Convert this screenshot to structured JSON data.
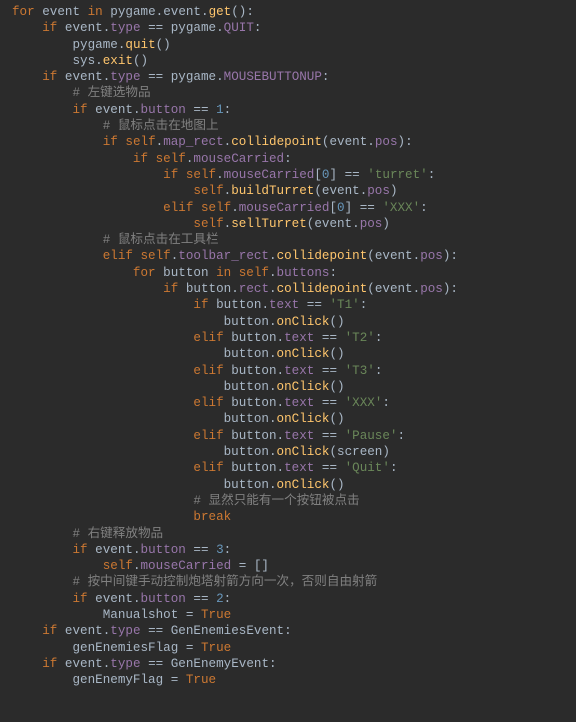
{
  "code": {
    "lines": [
      [
        [
          "kw",
          "for "
        ],
        [
          "id",
          "event "
        ],
        [
          "kw",
          "in "
        ],
        [
          "id",
          "pygame"
        ],
        [
          "op",
          "."
        ],
        [
          "id",
          "event"
        ],
        [
          "op",
          "."
        ],
        [
          "fn",
          "get"
        ],
        [
          "op",
          "():"
        ]
      ],
      [
        [
          "op",
          "    "
        ],
        [
          "kw",
          "if "
        ],
        [
          "id",
          "event"
        ],
        [
          "op",
          "."
        ],
        [
          "attr",
          "type"
        ],
        [
          "op",
          " == "
        ],
        [
          "id",
          "pygame"
        ],
        [
          "op",
          "."
        ],
        [
          "attr",
          "QUIT"
        ],
        [
          "op",
          ":"
        ]
      ],
      [
        [
          "op",
          "        "
        ],
        [
          "id",
          "pygame"
        ],
        [
          "op",
          "."
        ],
        [
          "fn",
          "quit"
        ],
        [
          "op",
          "()"
        ]
      ],
      [
        [
          "op",
          "        "
        ],
        [
          "id",
          "sys"
        ],
        [
          "op",
          "."
        ],
        [
          "fn",
          "exit"
        ],
        [
          "op",
          "()"
        ]
      ],
      [
        [
          "op",
          "    "
        ],
        [
          "kw",
          "if "
        ],
        [
          "id",
          "event"
        ],
        [
          "op",
          "."
        ],
        [
          "attr",
          "type"
        ],
        [
          "op",
          " == "
        ],
        [
          "id",
          "pygame"
        ],
        [
          "op",
          "."
        ],
        [
          "attr",
          "MOUSEBUTTONUP"
        ],
        [
          "op",
          ":"
        ]
      ],
      [
        [
          "op",
          "        "
        ],
        [
          "cmt",
          "# 左键选物品"
        ]
      ],
      [
        [
          "op",
          "        "
        ],
        [
          "kw",
          "if "
        ],
        [
          "id",
          "event"
        ],
        [
          "op",
          "."
        ],
        [
          "attr",
          "button"
        ],
        [
          "op",
          " == "
        ],
        [
          "num",
          "1"
        ],
        [
          "op",
          ":"
        ]
      ],
      [
        [
          "op",
          "            "
        ],
        [
          "cmt",
          "# 鼠标点击在地图上"
        ]
      ],
      [
        [
          "op",
          "            "
        ],
        [
          "kw",
          "if "
        ],
        [
          "kw",
          "self"
        ],
        [
          "op",
          "."
        ],
        [
          "attr",
          "map_rect"
        ],
        [
          "op",
          "."
        ],
        [
          "fn",
          "collidepoint"
        ],
        [
          "op",
          "("
        ],
        [
          "id",
          "event"
        ],
        [
          "op",
          "."
        ],
        [
          "attr",
          "pos"
        ],
        [
          "op",
          "):"
        ]
      ],
      [
        [
          "op",
          "                "
        ],
        [
          "kw",
          "if "
        ],
        [
          "kw",
          "self"
        ],
        [
          "op",
          "."
        ],
        [
          "attr",
          "mouseCarried"
        ],
        [
          "op",
          ":"
        ]
      ],
      [
        [
          "op",
          "                    "
        ],
        [
          "kw",
          "if "
        ],
        [
          "kw",
          "self"
        ],
        [
          "op",
          "."
        ],
        [
          "attr",
          "mouseCarried"
        ],
        [
          "op",
          "["
        ],
        [
          "num",
          "0"
        ],
        [
          "op",
          "] == "
        ],
        [
          "str",
          "'turret'"
        ],
        [
          "op",
          ":"
        ]
      ],
      [
        [
          "op",
          "                        "
        ],
        [
          "kw",
          "self"
        ],
        [
          "op",
          "."
        ],
        [
          "fn",
          "buildTurret"
        ],
        [
          "op",
          "("
        ],
        [
          "id",
          "event"
        ],
        [
          "op",
          "."
        ],
        [
          "attr",
          "pos"
        ],
        [
          "op",
          ")"
        ]
      ],
      [
        [
          "op",
          "                    "
        ],
        [
          "kw",
          "elif "
        ],
        [
          "kw",
          "self"
        ],
        [
          "op",
          "."
        ],
        [
          "attr",
          "mouseCarried"
        ],
        [
          "op",
          "["
        ],
        [
          "num",
          "0"
        ],
        [
          "op",
          "] == "
        ],
        [
          "str",
          "'XXX'"
        ],
        [
          "op",
          ":"
        ]
      ],
      [
        [
          "op",
          "                        "
        ],
        [
          "kw",
          "self"
        ],
        [
          "op",
          "."
        ],
        [
          "fn",
          "sellTurret"
        ],
        [
          "op",
          "("
        ],
        [
          "id",
          "event"
        ],
        [
          "op",
          "."
        ],
        [
          "attr",
          "pos"
        ],
        [
          "op",
          ")"
        ]
      ],
      [
        [
          "op",
          "            "
        ],
        [
          "cmt",
          "# 鼠标点击在工具栏"
        ]
      ],
      [
        [
          "op",
          "            "
        ],
        [
          "kw",
          "elif "
        ],
        [
          "kw",
          "self"
        ],
        [
          "op",
          "."
        ],
        [
          "attr",
          "toolbar_rect"
        ],
        [
          "op",
          "."
        ],
        [
          "fn",
          "collidepoint"
        ],
        [
          "op",
          "("
        ],
        [
          "id",
          "event"
        ],
        [
          "op",
          "."
        ],
        [
          "attr",
          "pos"
        ],
        [
          "op",
          "):"
        ]
      ],
      [
        [
          "op",
          "                "
        ],
        [
          "kw",
          "for "
        ],
        [
          "id",
          "button "
        ],
        [
          "kw",
          "in "
        ],
        [
          "kw",
          "self"
        ],
        [
          "op",
          "."
        ],
        [
          "attr",
          "buttons"
        ],
        [
          "op",
          ":"
        ]
      ],
      [
        [
          "op",
          "                    "
        ],
        [
          "kw",
          "if "
        ],
        [
          "id",
          "button"
        ],
        [
          "op",
          "."
        ],
        [
          "attr",
          "rect"
        ],
        [
          "op",
          "."
        ],
        [
          "fn",
          "collidepoint"
        ],
        [
          "op",
          "("
        ],
        [
          "id",
          "event"
        ],
        [
          "op",
          "."
        ],
        [
          "attr",
          "pos"
        ],
        [
          "op",
          "):"
        ]
      ],
      [
        [
          "op",
          "                        "
        ],
        [
          "kw",
          "if "
        ],
        [
          "id",
          "button"
        ],
        [
          "op",
          "."
        ],
        [
          "attr",
          "text"
        ],
        [
          "op",
          " == "
        ],
        [
          "str",
          "'T1'"
        ],
        [
          "op",
          ":"
        ]
      ],
      [
        [
          "op",
          "                            "
        ],
        [
          "id",
          "button"
        ],
        [
          "op",
          "."
        ],
        [
          "fn",
          "onClick"
        ],
        [
          "op",
          "()"
        ]
      ],
      [
        [
          "op",
          "                        "
        ],
        [
          "kw",
          "elif "
        ],
        [
          "id",
          "button"
        ],
        [
          "op",
          "."
        ],
        [
          "attr",
          "text"
        ],
        [
          "op",
          " == "
        ],
        [
          "str",
          "'T2'"
        ],
        [
          "op",
          ":"
        ]
      ],
      [
        [
          "op",
          "                            "
        ],
        [
          "id",
          "button"
        ],
        [
          "op",
          "."
        ],
        [
          "fn",
          "onClick"
        ],
        [
          "op",
          "()"
        ]
      ],
      [
        [
          "op",
          "                        "
        ],
        [
          "kw",
          "elif "
        ],
        [
          "id",
          "button"
        ],
        [
          "op",
          "."
        ],
        [
          "attr",
          "text"
        ],
        [
          "op",
          " == "
        ],
        [
          "str",
          "'T3'"
        ],
        [
          "op",
          ":"
        ]
      ],
      [
        [
          "op",
          "                            "
        ],
        [
          "id",
          "button"
        ],
        [
          "op",
          "."
        ],
        [
          "fn",
          "onClick"
        ],
        [
          "op",
          "()"
        ]
      ],
      [
        [
          "op",
          "                        "
        ],
        [
          "kw",
          "elif "
        ],
        [
          "id",
          "button"
        ],
        [
          "op",
          "."
        ],
        [
          "attr",
          "text"
        ],
        [
          "op",
          " == "
        ],
        [
          "str",
          "'XXX'"
        ],
        [
          "op",
          ":"
        ]
      ],
      [
        [
          "op",
          "                            "
        ],
        [
          "id",
          "button"
        ],
        [
          "op",
          "."
        ],
        [
          "fn",
          "onClick"
        ],
        [
          "op",
          "()"
        ]
      ],
      [
        [
          "op",
          "                        "
        ],
        [
          "kw",
          "elif "
        ],
        [
          "id",
          "button"
        ],
        [
          "op",
          "."
        ],
        [
          "attr",
          "text"
        ],
        [
          "op",
          " == "
        ],
        [
          "str",
          "'Pause'"
        ],
        [
          "op",
          ":"
        ]
      ],
      [
        [
          "op",
          "                            "
        ],
        [
          "id",
          "button"
        ],
        [
          "op",
          "."
        ],
        [
          "fn",
          "onClick"
        ],
        [
          "op",
          "("
        ],
        [
          "id",
          "screen"
        ],
        [
          "op",
          ")"
        ]
      ],
      [
        [
          "op",
          "                        "
        ],
        [
          "kw",
          "elif "
        ],
        [
          "id",
          "button"
        ],
        [
          "op",
          "."
        ],
        [
          "attr",
          "text"
        ],
        [
          "op",
          " == "
        ],
        [
          "str",
          "'Quit'"
        ],
        [
          "op",
          ":"
        ]
      ],
      [
        [
          "op",
          "                            "
        ],
        [
          "id",
          "button"
        ],
        [
          "op",
          "."
        ],
        [
          "fn",
          "onClick"
        ],
        [
          "op",
          "()"
        ]
      ],
      [
        [
          "op",
          "                        "
        ],
        [
          "cmt",
          "# 显然只能有一个按钮被点击"
        ]
      ],
      [
        [
          "op",
          "                        "
        ],
        [
          "kw",
          "break"
        ]
      ],
      [
        [
          "op",
          "        "
        ],
        [
          "cmt",
          "# 右键释放物品"
        ]
      ],
      [
        [
          "op",
          "        "
        ],
        [
          "kw",
          "if "
        ],
        [
          "id",
          "event"
        ],
        [
          "op",
          "."
        ],
        [
          "attr",
          "button"
        ],
        [
          "op",
          " == "
        ],
        [
          "num",
          "3"
        ],
        [
          "op",
          ":"
        ]
      ],
      [
        [
          "op",
          "            "
        ],
        [
          "kw",
          "self"
        ],
        [
          "op",
          "."
        ],
        [
          "attr",
          "mouseCarried"
        ],
        [
          "op",
          " = []"
        ]
      ],
      [
        [
          "op",
          "        "
        ],
        [
          "cmt",
          "# 按中间键手动控制炮塔射箭方向一次，否则自由射箭"
        ]
      ],
      [
        [
          "op",
          "        "
        ],
        [
          "kw",
          "if "
        ],
        [
          "id",
          "event"
        ],
        [
          "op",
          "."
        ],
        [
          "attr",
          "button"
        ],
        [
          "op",
          " == "
        ],
        [
          "num",
          "2"
        ],
        [
          "op",
          ":"
        ]
      ],
      [
        [
          "op",
          "            "
        ],
        [
          "id",
          "Manualshot"
        ],
        [
          "op",
          " = "
        ],
        [
          "kw",
          "True"
        ]
      ],
      [
        [
          "op",
          "    "
        ],
        [
          "kw",
          "if "
        ],
        [
          "id",
          "event"
        ],
        [
          "op",
          "."
        ],
        [
          "attr",
          "type"
        ],
        [
          "op",
          " == "
        ],
        [
          "id",
          "GenEnemiesEvent"
        ],
        [
          "op",
          ":"
        ]
      ],
      [
        [
          "op",
          "        "
        ],
        [
          "id",
          "genEnemiesFlag"
        ],
        [
          "op",
          " = "
        ],
        [
          "kw",
          "True"
        ]
      ],
      [
        [
          "op",
          "    "
        ],
        [
          "kw",
          "if "
        ],
        [
          "id",
          "event"
        ],
        [
          "op",
          "."
        ],
        [
          "attr",
          "type"
        ],
        [
          "op",
          " == "
        ],
        [
          "id",
          "GenEnemyEvent"
        ],
        [
          "op",
          ":"
        ]
      ],
      [
        [
          "op",
          "        "
        ],
        [
          "id",
          "genEnemyFlag"
        ],
        [
          "op",
          " = "
        ],
        [
          "kw",
          "True"
        ]
      ]
    ]
  }
}
